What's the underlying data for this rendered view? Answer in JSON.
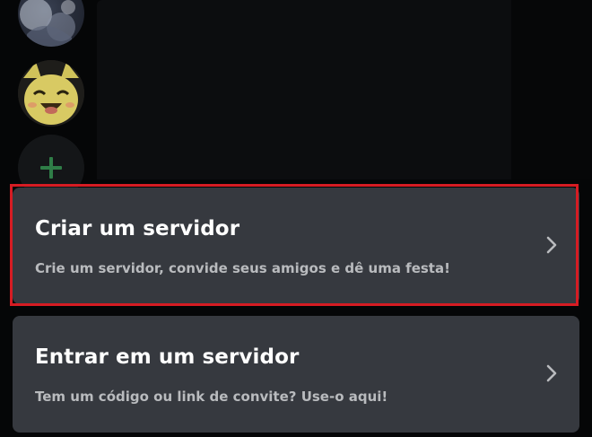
{
  "colors": {
    "card_background": "#36393f",
    "title_text": "#ffffff",
    "description_text": "#b9bbbe",
    "highlight_border": "#d61c23",
    "add_server_plus": "#3ba55d"
  },
  "background": {
    "servers": [
      {
        "icon": "server-avatar-anime-icon"
      },
      {
        "icon": "server-avatar-cartoon-character-icon"
      }
    ],
    "add_server_icon": "plus-icon"
  },
  "options": [
    {
      "title": "Criar um servidor",
      "description": "Crie um servidor, convide seus amigos e dê uma festa!",
      "icon": "chevron-right-icon",
      "highlighted": true
    },
    {
      "title": "Entrar em um servidor",
      "description": "Tem um código ou link de convite? Use-o aqui!",
      "icon": "chevron-right-icon",
      "highlighted": false
    }
  ]
}
